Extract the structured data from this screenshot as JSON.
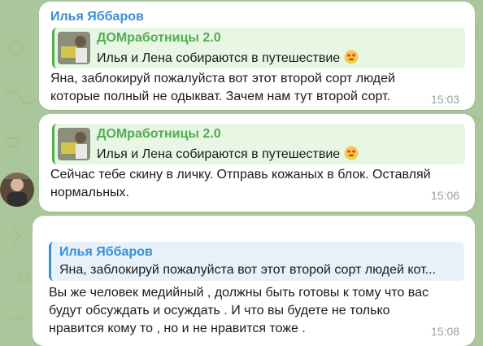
{
  "colors": {
    "background": "#a9c79a",
    "bubble": "#ffffff",
    "sender_blue": "#3a8fd4",
    "reply_green": "#4fae4e",
    "time_gray": "#9aa0a6"
  },
  "messages": [
    {
      "sender": "Илья Яббаров",
      "reply": {
        "title": "ДОМработницы 2.0",
        "text": "Илья и Лена собираются в путешествие",
        "emoji": "heart-eyes-emoji"
      },
      "text": "Яна, заблокируй пожалуйста вот этот второй сорт людей\nкоторые полный не одыкват. Зачем нам тут второй сорт.",
      "time": "15:03"
    },
    {
      "reply": {
        "title": "ДОМработницы 2.0",
        "text": "Илья и Лена собираются в путешествие",
        "emoji": "heart-eyes-emoji"
      },
      "text": "Сейчас тебе скину в личку. Отправь кожаных в блок. Оставляй\nнормальных.",
      "time": "15:06"
    },
    {
      "reply": {
        "title": "Илья Яббаров",
        "text": "Яна, заблокируй пожалуйста вот этот второй сорт людей кот..."
      },
      "text": "Вы же человек медийный , должны быть готовы к тому что вас\nбудут обсуждать и осуждать . И что вы будете не только\nнравится кому то , но и не нравится тоже .",
      "time": "15:08"
    }
  ]
}
